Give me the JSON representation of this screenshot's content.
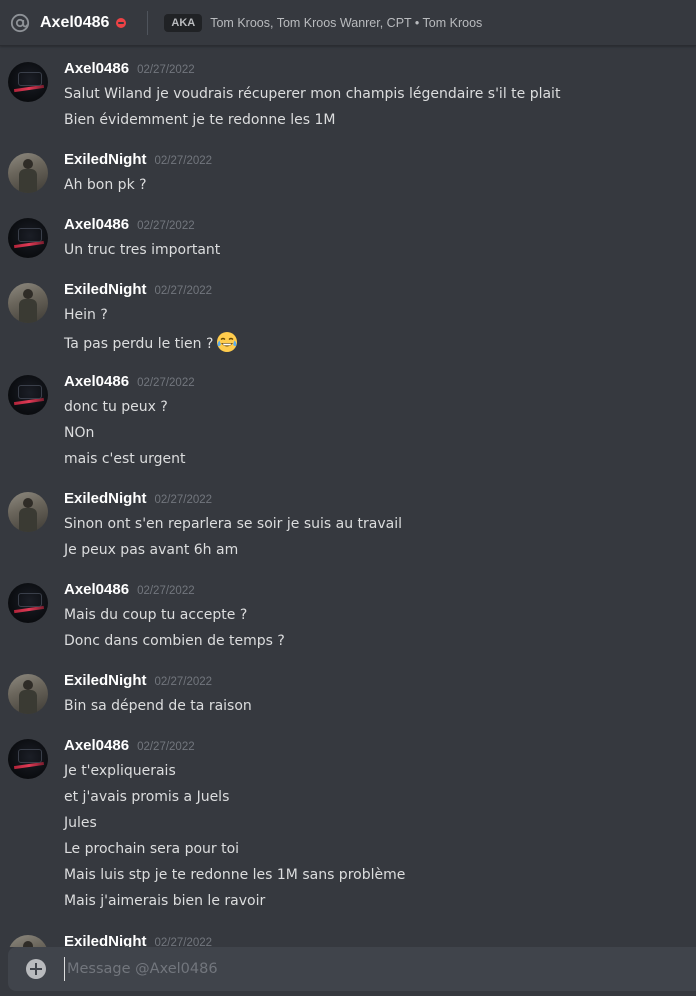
{
  "header": {
    "icon": "at-icon",
    "title": "Axel0486",
    "status_icon": "do-not-disturb-icon",
    "aka_label": "AKA",
    "aka_names": "Tom Kroos, Tom Kroos Wanrer, CPT • Tom Kroos"
  },
  "messages": [
    {
      "author": "Axel0486",
      "timestamp": "02/27/2022",
      "lines": [
        "Salut Wiland je voudrais récuperer mon champis légendaire s'il te plait",
        "Bien évidemment je te redonne les 1M"
      ]
    },
    {
      "author": "ExiledNight",
      "timestamp": "02/27/2022",
      "lines": [
        "Ah bon pk ?"
      ]
    },
    {
      "author": "Axel0486",
      "timestamp": "02/27/2022",
      "lines": [
        "Un truc tres important"
      ]
    },
    {
      "author": "ExiledNight",
      "timestamp": "02/27/2022",
      "lines": [
        "Hein ?",
        "Ta pas perdu le tien ?"
      ],
      "emoji": "joy-emoji"
    },
    {
      "author": "Axel0486",
      "timestamp": "02/27/2022",
      "lines": [
        "donc tu peux ?",
        "NOn",
        "mais c'est urgent"
      ]
    },
    {
      "author": "ExiledNight",
      "timestamp": "02/27/2022",
      "lines": [
        "Sinon ont s'en reparlera se soir je suis au travail",
        "Je peux pas avant 6h am"
      ]
    },
    {
      "author": "Axel0486",
      "timestamp": "02/27/2022",
      "lines": [
        "Mais du coup tu accepte ?",
        "Donc dans combien de temps ?"
      ]
    },
    {
      "author": "ExiledNight",
      "timestamp": "02/27/2022",
      "lines": [
        "Bin sa dépend de ta raison"
      ]
    },
    {
      "author": "Axel0486",
      "timestamp": "02/27/2022",
      "lines": [
        "Je t'expliquerais",
        "et j'avais promis a Juels",
        "Jules",
        "Le prochain sera pour toi",
        "Mais luis stp je te redonne les 1M sans problème",
        "Mais j'aimerais bien le ravoir"
      ]
    },
    {
      "author": "ExiledNight",
      "timestamp": "02/27/2022",
      "lines": []
    }
  ],
  "composer": {
    "attach_icon": "plus-circle-icon",
    "placeholder": "Message @Axel0486"
  },
  "colors": {
    "background": "#36393f",
    "composer": "#40444b",
    "text": "#dcddde",
    "username": "#ffffff",
    "timestamp": "#72767d",
    "dnd_status": "#ed4245"
  }
}
